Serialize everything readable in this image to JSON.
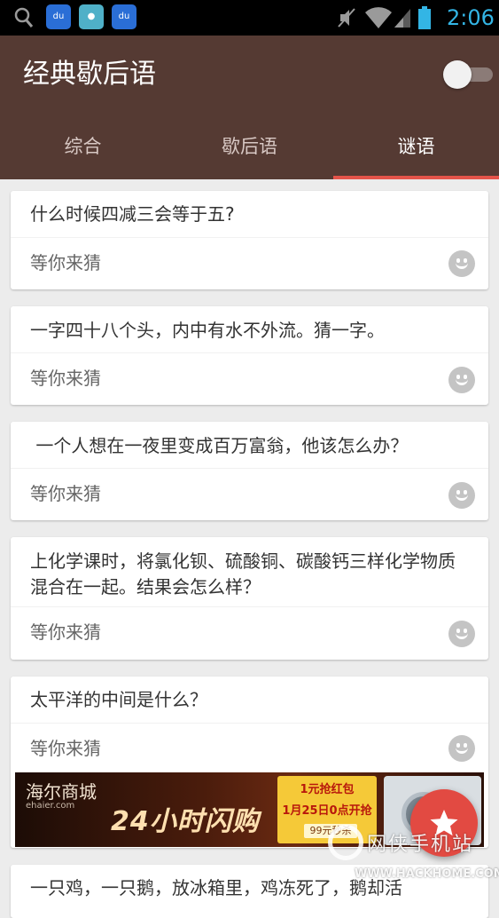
{
  "status_bar": {
    "time": "2:06",
    "icons": [
      "search-icon",
      "baidu-app-icon",
      "hiapp-icon",
      "baidu-app-icon",
      "mute-icon",
      "wifi-icon",
      "signal-icon",
      "battery-icon"
    ],
    "accent": "#33b5e5"
  },
  "app": {
    "title": "经典歇后语",
    "toggle_on": false,
    "colors": {
      "app_bar": "#553a33",
      "tab_indicator": "#e4544a",
      "fab": "#e24a42"
    }
  },
  "tabs": [
    {
      "label": "综合",
      "selected": false
    },
    {
      "label": "歇后语",
      "selected": false
    },
    {
      "label": "谜语",
      "selected": true
    }
  ],
  "cards": [
    {
      "question": "什么时候四减三会等于五?",
      "answer": "等你来猜"
    },
    {
      "question": "一字四十八个头，内中有水不外流。猜一字。",
      "answer": "等你来猜"
    },
    {
      "question": " 一个人想在一夜里变成百万富翁，他该怎么办？",
      "answer": "等你来猜"
    },
    {
      "question": "上化学课时，将氯化钡、硫酸铜、碳酸钙三样化学物质混合在一起。结果会怎么样？",
      "answer": "等你来猜"
    },
    {
      "question": "太平洋的中间是什么？",
      "answer": "等你来猜"
    },
    {
      "question": "一只鸡，一只鹅，放冰箱里，鸡冻死了，鹅却活",
      "answer": ""
    }
  ],
  "ad": {
    "brand": "海尔商城",
    "brand_sub": "ehaier.com",
    "slogan": "24小时闪购",
    "panel_title": "1元抢红包",
    "panel_date": "1月25日0点开抢",
    "panel_price": "99元秒杀"
  },
  "fab": {
    "icon": "star-icon"
  },
  "watermark": {
    "text": "网侠手机站",
    "url": "WWW.HACKHOME.COM"
  }
}
